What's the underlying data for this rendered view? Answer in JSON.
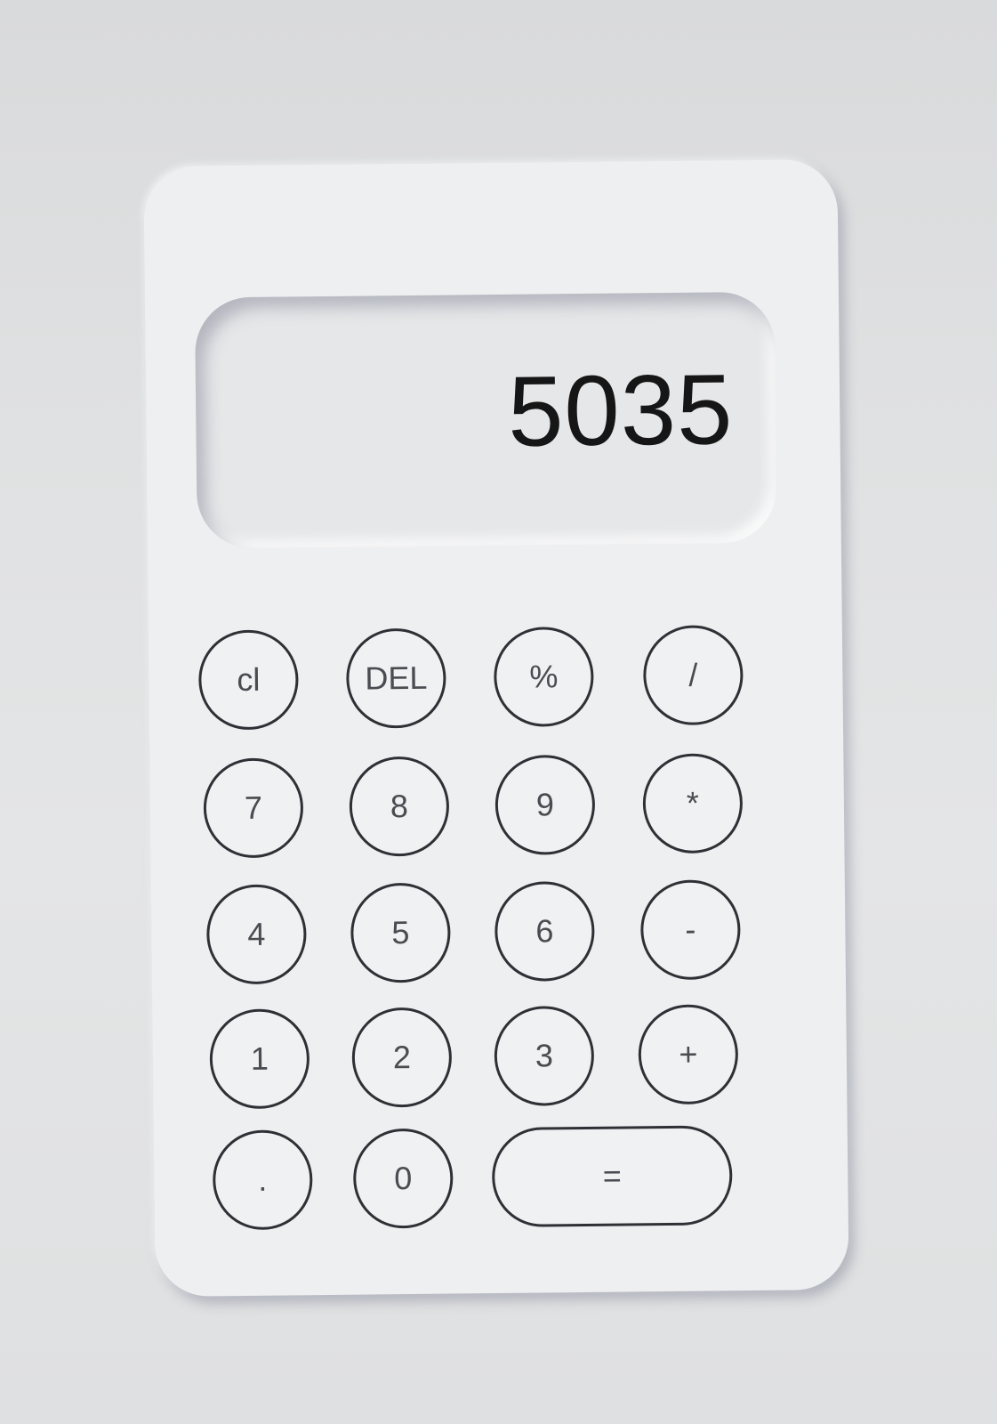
{
  "display": {
    "value": "5035"
  },
  "keypad": {
    "clear": "cl",
    "delete": "DEL",
    "percent": "%",
    "divide": "/",
    "seven": "7",
    "eight": "8",
    "nine": "9",
    "multiply": "*",
    "four": "4",
    "five": "5",
    "six": "6",
    "subtract": "-",
    "one": "1",
    "two": "2",
    "three": "3",
    "add": "+",
    "decimal": ".",
    "zero": "0",
    "equals": "="
  }
}
